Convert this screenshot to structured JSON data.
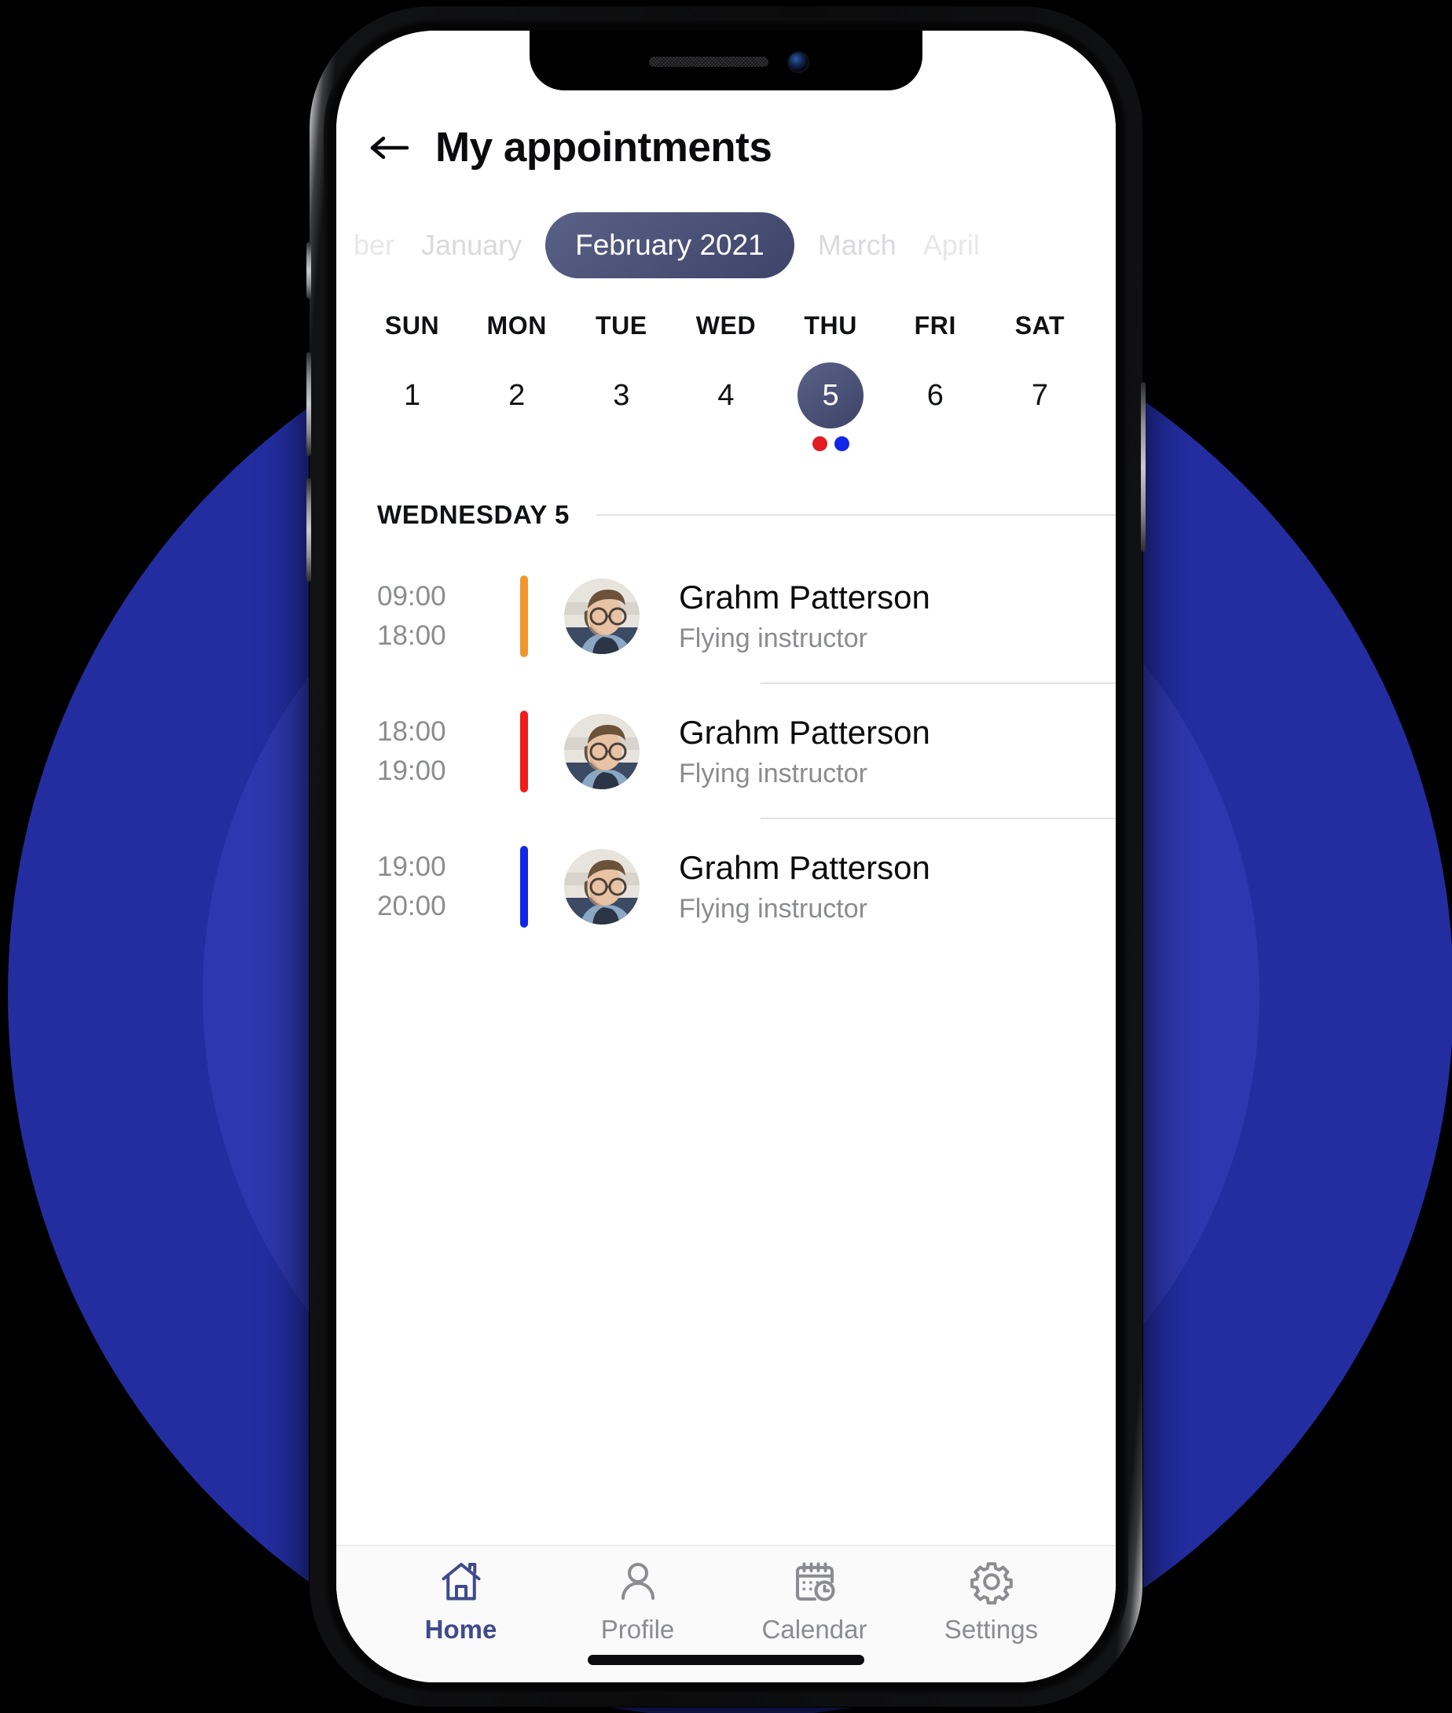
{
  "background": {
    "outer_circle_color": "#232da0",
    "inner_circle_color": "#2f37ae"
  },
  "header": {
    "back_icon": "arrow-left-icon",
    "title": "My appointments"
  },
  "month_strip": {
    "months": [
      {
        "label": "ber",
        "state": "cut-off"
      },
      {
        "label": "January",
        "state": "inactive"
      },
      {
        "label": "February 2021",
        "state": "active"
      },
      {
        "label": "March",
        "state": "inactive"
      },
      {
        "label": "April",
        "state": "cut-off"
      }
    ],
    "active_pill_color": "#454b70"
  },
  "calendar": {
    "weekdays": [
      "SUN",
      "MON",
      "TUE",
      "WED",
      "THU",
      "FRI",
      "SAT"
    ],
    "days": [
      {
        "num": "1",
        "selected": false,
        "dots": []
      },
      {
        "num": "2",
        "selected": false,
        "dots": []
      },
      {
        "num": "3",
        "selected": false,
        "dots": []
      },
      {
        "num": "4",
        "selected": false,
        "dots": []
      },
      {
        "num": "5",
        "selected": true,
        "dots": [
          "#e01b22",
          "#1226e8"
        ]
      },
      {
        "num": "6",
        "selected": false,
        "dots": []
      },
      {
        "num": "7",
        "selected": false,
        "dots": []
      }
    ],
    "selected_day_color": "#4a5076"
  },
  "day_section": {
    "title": "WEDNESDAY 5"
  },
  "appointments": [
    {
      "start": "09:00",
      "end": "18:00",
      "bar_color": "#f0962f",
      "avatar": "person-avatar",
      "name": "Grahm Patterson",
      "role": "Flying instructor"
    },
    {
      "start": "18:00",
      "end": "19:00",
      "bar_color": "#ee1c1c",
      "avatar": "person-avatar",
      "name": "Grahm Patterson",
      "role": "Flying instructor"
    },
    {
      "start": "19:00",
      "end": "20:00",
      "bar_color": "#1226e8",
      "avatar": "person-avatar",
      "name": "Grahm Patterson",
      "role": "Flying instructor"
    }
  ],
  "tabbar": {
    "active_color": "#3f4a8c",
    "inactive_color": "#8b8c90",
    "tabs": [
      {
        "label": "Home",
        "icon": "home-icon",
        "active": true
      },
      {
        "label": "Profile",
        "icon": "user-icon",
        "active": false
      },
      {
        "label": "Calendar",
        "icon": "calendar-clock-icon",
        "active": false
      },
      {
        "label": "Settings",
        "icon": "gear-icon",
        "active": false
      }
    ]
  }
}
